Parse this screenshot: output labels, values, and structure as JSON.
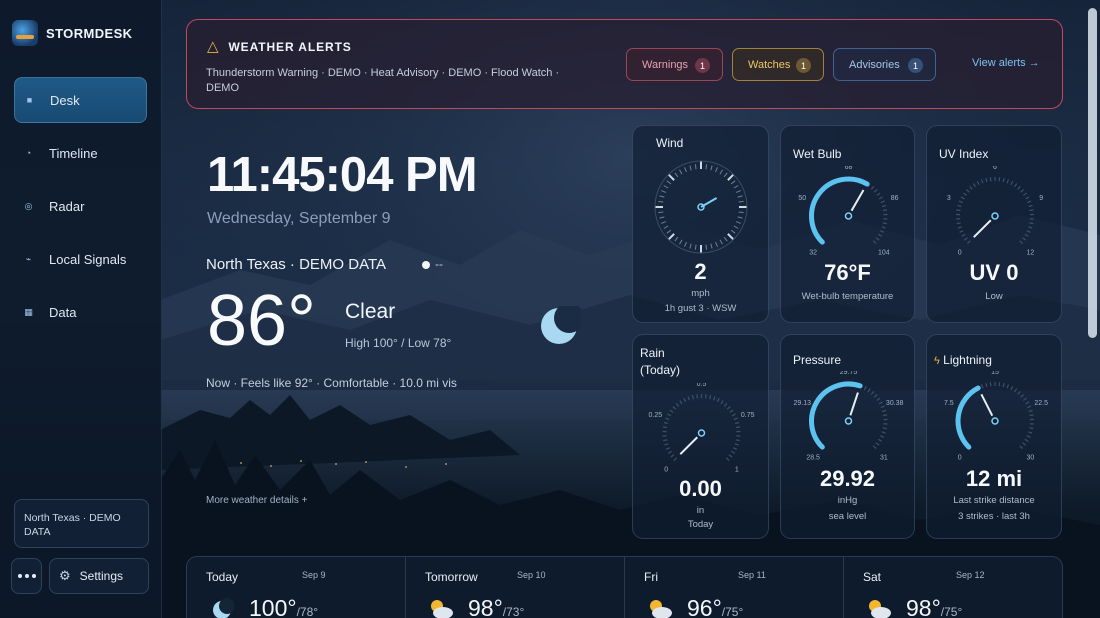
{
  "app": {
    "name": "STORMDESK"
  },
  "sidebar": {
    "items": [
      {
        "label": "Desk",
        "icon": "grid-icon",
        "active": true
      },
      {
        "label": "Timeline",
        "icon": "clock-icon",
        "active": false
      },
      {
        "label": "Radar",
        "icon": "radar-icon",
        "active": false
      },
      {
        "label": "Local Signals",
        "icon": "signal-icon",
        "active": false
      },
      {
        "label": "Data",
        "icon": "table-icon",
        "active": false
      }
    ],
    "location": "North Texas · DEMO DATA",
    "settings_label": "Settings"
  },
  "alerts": {
    "title": "WEATHER ALERTS",
    "text": "Thunderstorm Warning · DEMO · Heat Advisory · DEMO · Flood Watch · DEMO",
    "warnings": {
      "label": "Warnings",
      "count": "1"
    },
    "watches": {
      "label": "Watches",
      "count": "1"
    },
    "advisories": {
      "label": "Advisories",
      "count": "1"
    },
    "view_link": "View alerts →"
  },
  "hero": {
    "time": "11:45:04 PM",
    "date": "Wednesday, September 9",
    "location": "North Texas · DEMO DATA",
    "location_status": "--",
    "temperature": "86°",
    "condition": "Clear",
    "hilo": "High 100° / Low 78°",
    "summary": "Now · Feels like 92° · Comfortable · 10.0 mi vis",
    "more_details": "More weather details +"
  },
  "gauges": {
    "wind": {
      "title": "Wind",
      "value": "2",
      "unit": "mph",
      "note": "1h gust 3 · WSW",
      "direction_deg": 60
    },
    "wetbulb": {
      "title": "Wet Bulb",
      "value": "76°F",
      "note": "Wet-bulb temperature",
      "ticks": [
        "32",
        "50",
        "68",
        "86",
        "104"
      ],
      "min": 32,
      "max": 104,
      "reading": 76
    },
    "uv": {
      "title": "UV Index",
      "value": "UV 0",
      "note": "Low",
      "ticks": [
        "0",
        "3",
        "6",
        "9",
        "12"
      ],
      "min": 0,
      "max": 12,
      "reading": 0
    },
    "rain": {
      "title_line1": "Rain",
      "title_line2": "(Today)",
      "value": "0.00",
      "unit": "in",
      "note": "Today",
      "ticks": [
        "0",
        "0.25",
        "0.5",
        "0.75",
        "1"
      ],
      "min": 0,
      "max": 1,
      "reading": 0
    },
    "pressure": {
      "title": "Pressure",
      "value": "29.92",
      "unit": "inHg",
      "note": "sea level",
      "ticks": [
        "28.5",
        "29.13",
        "29.75",
        "30.38",
        "31"
      ],
      "min": 28.5,
      "max": 31,
      "reading": 29.92
    },
    "lightning": {
      "title": "Lightning",
      "value": "12 mi",
      "note": "Last strike distance",
      "note2": "3 strikes · last 3h",
      "ticks": [
        "0",
        "7.5",
        "15",
        "22.5",
        "30"
      ],
      "min": 0,
      "max": 30,
      "reading": 12
    }
  },
  "forecast": [
    {
      "name": "Today",
      "date": "Sep 9",
      "hi": "100°",
      "lo": "/78°",
      "icon": "moon-icon"
    },
    {
      "name": "Tomorrow",
      "date": "Sep 10",
      "hi": "98°",
      "lo": "/73°",
      "icon": "sun-cloud-icon"
    },
    {
      "name": "Fri",
      "date": "Sep 11",
      "hi": "96°",
      "lo": "/75°",
      "icon": "sun-cloud-icon"
    },
    {
      "name": "Sat",
      "date": "Sep 12",
      "hi": "98°",
      "lo": "/75°",
      "icon": "sun-cloud-icon"
    }
  ],
  "colors": {
    "accent": "#5cc3f0",
    "alert_border": "#c2485c",
    "warning": "#e8b33e"
  }
}
